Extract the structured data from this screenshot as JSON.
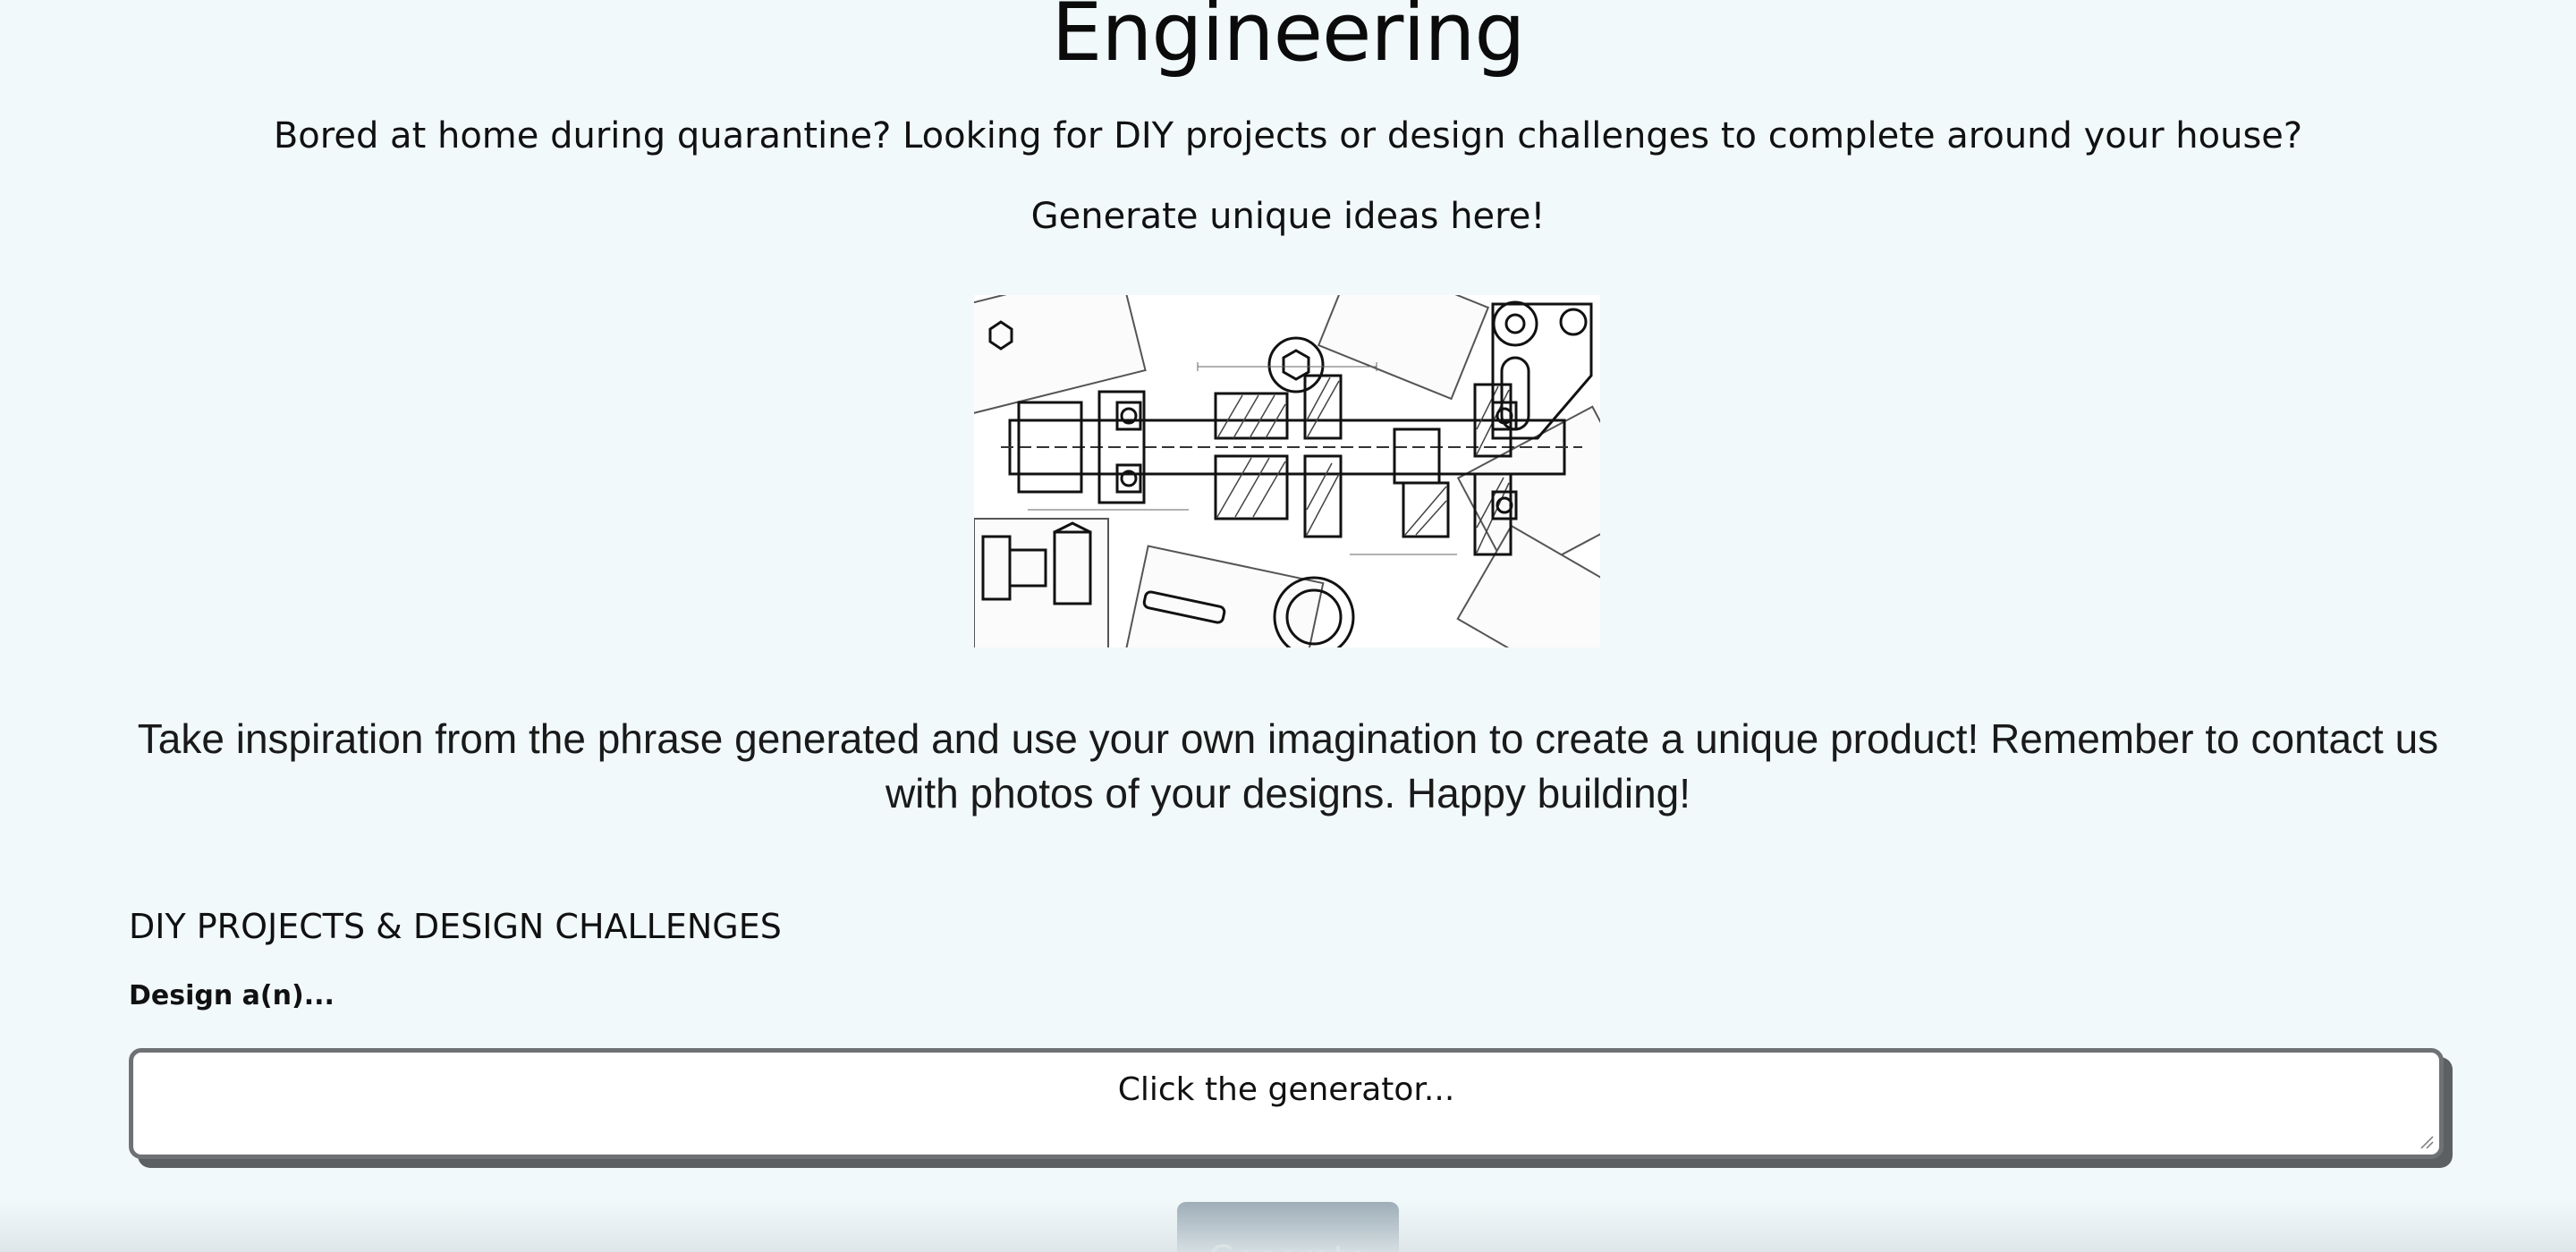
{
  "header": {
    "title": "Engineering",
    "tagline": "Bored at home during quarantine? Looking for DIY projects or design challenges to complete around your house?",
    "call_to_action": "Generate unique ideas here!"
  },
  "hero_image": {
    "icon": "technical-drawing-image"
  },
  "intro": {
    "text": "Take inspiration from the phrase generated and use your own imagination to create a unique product! Remember to contact us with photos of your designs. Happy building!"
  },
  "generator": {
    "heading": "DIY PROJECTS & DESIGN CHALLENGES",
    "label": "Design a(n)...",
    "output_value": "Click the generator...",
    "button_label": "Generate"
  },
  "colors": {
    "background": "#f1f9fb",
    "button": "#9aaab5",
    "box_border": "#6f7174"
  }
}
